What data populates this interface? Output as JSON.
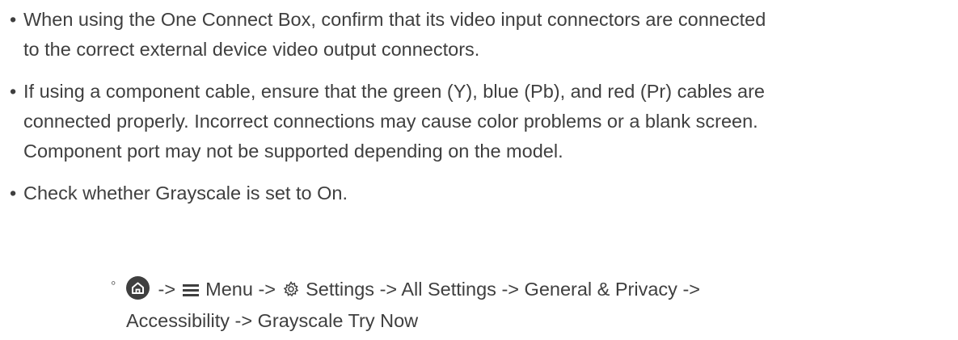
{
  "bullets": [
    {
      "line1": "When using the One Connect Box, confirm that its video input connectors are connected",
      "line2": "to the correct external device video output connectors."
    },
    {
      "line1": "If using a component cable, ensure that the green (Y), blue (Pb), and red (Pr) cables are",
      "line2": "connected properly. Incorrect connections may cause color problems or a blank screen.",
      "line3": "Component port may not be supported depending on the model."
    },
    {
      "line1": "Check whether Grayscale is set to On."
    }
  ],
  "path": {
    "arrow": "->",
    "menu": "Menu",
    "settings": "Settings",
    "all_settings": "All Settings",
    "general_privacy": "General & Privacy",
    "accessibility": "Accessibility",
    "grayscale": "Grayscale",
    "try_now": "Try Now"
  },
  "icons": {
    "bullet": "•",
    "sub_bullet": "◦",
    "home": "home-icon",
    "menu": "hamburger-menu-icon",
    "settings": "gear-icon"
  }
}
